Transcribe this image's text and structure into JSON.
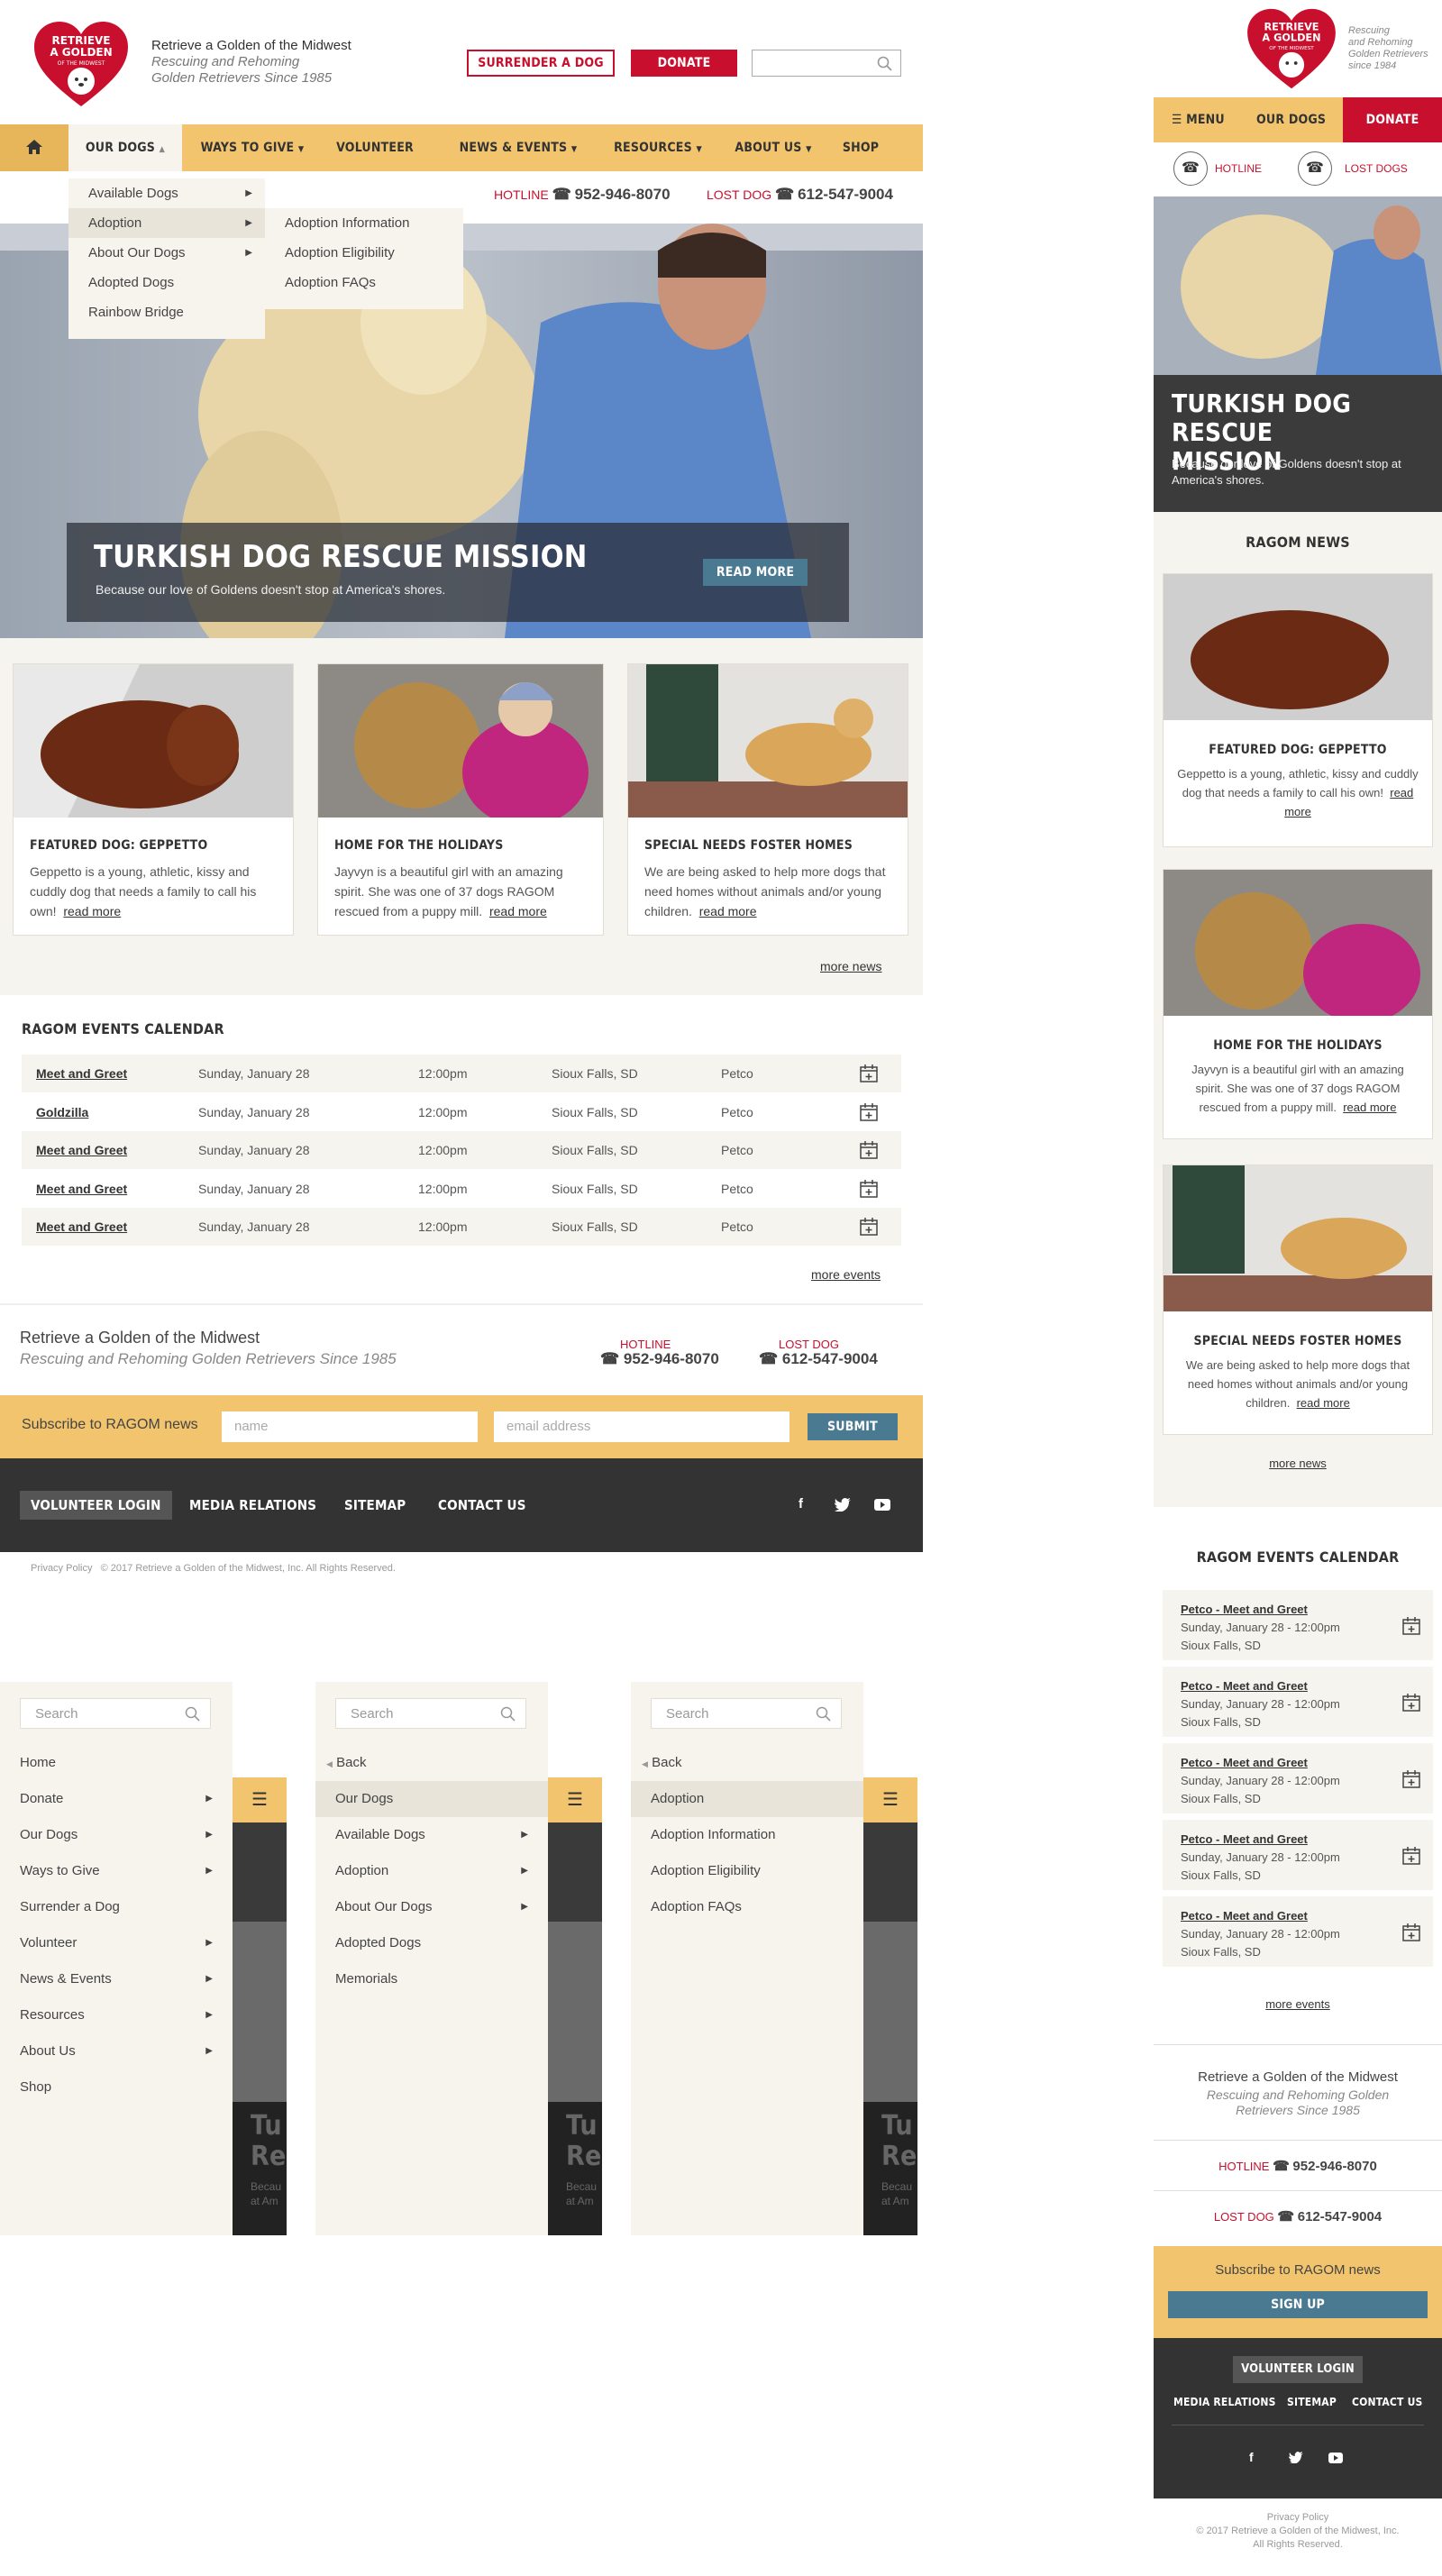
{
  "colors": {
    "red": "#c8102e",
    "gold": "#f2c46e",
    "cream": "#f6f4ee",
    "dark": "#333333",
    "blue": "#4a7a92"
  },
  "brand": {
    "logo_text": "Retrieve a Golden of the Midwest",
    "name": "Retrieve a Golden of the Midwest",
    "tagline_line1": "Rescuing and Rehoming",
    "tagline_line2": "Golden Retrievers Since 1985"
  },
  "header": {
    "surrender_label": "Surrender a Dog",
    "donate_label": "Donate",
    "search_placeholder": ""
  },
  "nav": {
    "home_icon": "home-icon",
    "items": [
      "Our Dogs",
      "Ways to Give",
      "Volunteer",
      "News & Events",
      "Resources",
      "About Us",
      "Shop"
    ]
  },
  "dropdown": {
    "level1": [
      "Available Dogs",
      "Adoption",
      "About Our Dogs",
      "Adopted Dogs",
      "Rainbow Bridge"
    ],
    "level2": [
      "Adoption Information",
      "Adoption Eligibility",
      "Adoption FAQs"
    ]
  },
  "contact": {
    "hotline_label": "HOTLINE",
    "hotline_number": "952-946-8070",
    "lostdog_label": "LOST DOG",
    "lostdog_number": "612-547-9004"
  },
  "hero": {
    "title": "Turkish Dog Rescue Mission",
    "subtitle": "Because our love of Goldens doesn't stop at America's shores.",
    "button": "Read More"
  },
  "news": {
    "heading": "RAGOM News",
    "more": "more news",
    "read_more": "read more",
    "cards": [
      {
        "title": "Featured Dog: Geppetto",
        "text": "Geppetto is a young, athletic, kissy and cuddly dog that needs a family to call his own!"
      },
      {
        "title": "Home for the Holidays",
        "text": "Jayvyn is a beautiful girl with an amazing spirit. She was one of 37 dogs RAGOM rescued from a puppy mill."
      },
      {
        "title": "Special Needs Foster Homes",
        "text": "We are being asked to help more dogs that need  homes without animals and/or young children."
      }
    ]
  },
  "events": {
    "heading": "RAGOM Events Calendar",
    "more": "more events",
    "rows": [
      {
        "name": "Meet and Greet",
        "date": "Sunday, January 28",
        "time": "12:00pm",
        "city": "Sioux Falls, SD",
        "venue": "Petco"
      },
      {
        "name": "Goldzilla",
        "date": "Sunday, January 28",
        "time": "12:00pm",
        "city": "Sioux Falls, SD",
        "venue": "Petco"
      },
      {
        "name": "Meet and Greet",
        "date": "Sunday, January 28",
        "time": "12:00pm",
        "city": "Sioux Falls, SD",
        "venue": "Petco"
      },
      {
        "name": "Meet and Greet",
        "date": "Sunday, January 28",
        "time": "12:00pm",
        "city": "Sioux Falls, SD",
        "venue": "Petco"
      },
      {
        "name": "Meet and Greet",
        "date": "Sunday, January 28",
        "time": "12:00pm",
        "city": "Sioux Falls, SD",
        "venue": "Petco"
      }
    ],
    "mobile_rows": [
      {
        "name": "Petco - Meet and Greet",
        "when": "Sunday, January 28 - 12:00pm",
        "city": "Sioux Falls, SD"
      },
      {
        "name": "Petco - Meet and Greet",
        "when": "Sunday, January 28 - 12:00pm",
        "city": "Sioux Falls, SD"
      },
      {
        "name": "Petco - Meet and Greet",
        "when": "Sunday, January 28 - 12:00pm",
        "city": "Sioux Falls, SD"
      },
      {
        "name": "Petco - Meet and Greet",
        "when": "Sunday, January 28 - 12:00pm",
        "city": "Sioux Falls, SD"
      },
      {
        "name": "Petco - Meet and Greet",
        "when": "Sunday, January 28 - 12:00pm",
        "city": "Sioux Falls, SD"
      }
    ]
  },
  "footer": {
    "org": "Retrieve a Golden of the Midwest",
    "tagline": "Rescuing and Rehoming Golden Retrievers Since 1985",
    "mobile_tagline": "Rescuing and Rehoming Golden Retrievers Since 1985",
    "subscribe_label": "Subscribe to RAGOM news",
    "name_placeholder": "name",
    "email_placeholder": "email address",
    "submit": "Submit",
    "signup": "Sign Up",
    "links": [
      "Volunteer Login",
      "Media Relations",
      "Sitemap",
      "Contact Us"
    ],
    "privacy": "Privacy Policy",
    "copyright": "© 2017 Retrieve a Golden of the Midwest, Inc. All Rights Reserved.",
    "m_copy1": "© 2017 Retrieve a Golden of the Midwest, Inc.",
    "m_copy2": "All Rights Reserved."
  },
  "mobile": {
    "tagline1": "Rescuing",
    "tagline2": "and Rehoming",
    "tagline3": "Golden Retrievers",
    "tagline4": "since 1984",
    "menu": "Menu",
    "our_dogs": "Our Dogs",
    "donate": "Donate",
    "hotline": "HOTLINE",
    "lostdog": "LOST DOGS"
  },
  "drawers": {
    "search_placeholder": "Search",
    "back": "Back",
    "main": [
      "Home",
      "Donate",
      "Our Dogs",
      "Ways to Give",
      "Surrender a Dog",
      "Volunteer",
      "News & Events",
      "Resources",
      "About Us",
      "Shop"
    ],
    "dogs": [
      "Our Dogs",
      "Available Dogs",
      "Adoption",
      "About Our Dogs",
      "Adopted Dogs",
      "Memorials"
    ],
    "adoption": [
      "Adoption",
      "Adoption Information",
      "Adoption Eligibility",
      "Adoption FAQs"
    ],
    "peek_text1": "Tu",
    "peek_text2": "Re",
    "peek_text3": "Becau",
    "peek_text4": "at Am"
  }
}
